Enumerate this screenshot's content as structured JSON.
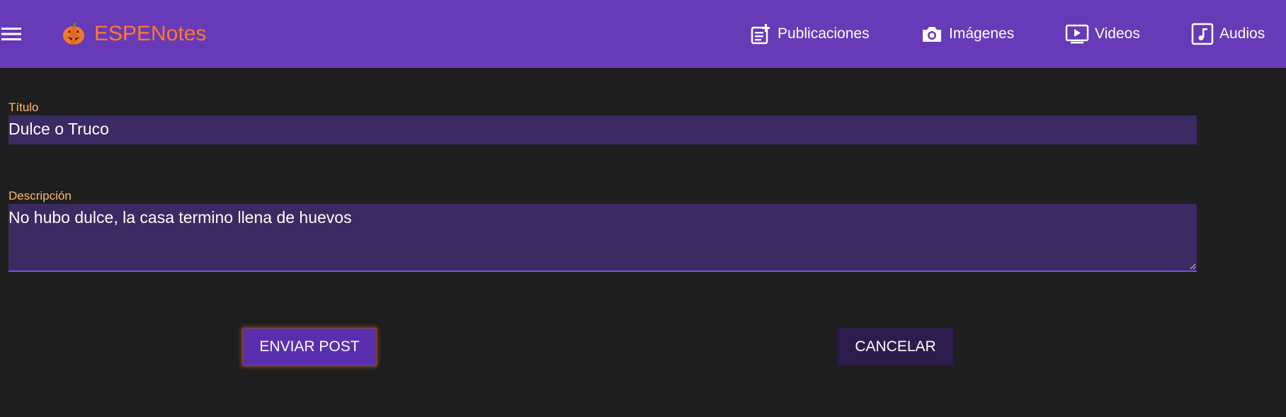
{
  "header": {
    "brand": "ESPENotes",
    "menu_icon": "hamburger-menu-icon",
    "logo_icon": "pumpkin-logo-icon",
    "nav": [
      {
        "label": "Publicaciones",
        "icon": "post-add-icon"
      },
      {
        "label": "Imágenes",
        "icon": "camera-icon"
      },
      {
        "label": "Videos",
        "icon": "video-play-icon"
      },
      {
        "label": "Audios",
        "icon": "music-note-icon"
      }
    ]
  },
  "form": {
    "title_label": "Título",
    "title_value": "Dulce o Truco",
    "description_label": "Descripción",
    "description_value": "No hubo dulce, la casa termino llena de huevos",
    "submit_label": "ENVIAR POST",
    "cancel_label": "CANCELAR"
  },
  "colors": {
    "topbar": "#673ab7",
    "brand": "#ff7a2a",
    "label": "#ffb86c",
    "field_bg": "#3c2a62",
    "background": "#1f1f1f",
    "primary_button": "#5a2fae",
    "secondary_button": "#2d1c4c"
  }
}
